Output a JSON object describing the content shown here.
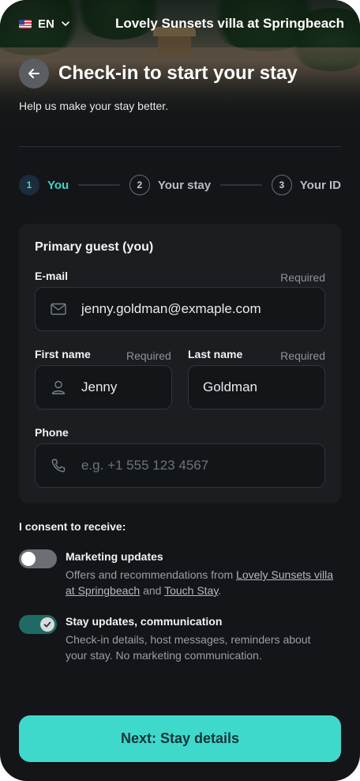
{
  "header": {
    "language": "EN",
    "property_name": "Lovely Sunsets villa at Springbeach",
    "title": "Check-in to start your stay",
    "subtitle": "Help us make your stay better."
  },
  "stepper": {
    "steps": [
      {
        "number": "1",
        "label": "You",
        "state": "active"
      },
      {
        "number": "2",
        "label": "Your stay",
        "state": "upcoming"
      },
      {
        "number": "3",
        "label": "Your ID",
        "state": "upcoming"
      }
    ]
  },
  "form": {
    "card_title": "Primary guest (you)",
    "email": {
      "label": "E-mail",
      "required_text": "Required",
      "value": "jenny.goldman@exmaple.com",
      "icon": "mail-icon"
    },
    "first_name": {
      "label": "First name",
      "required_text": "Required",
      "value": "Jenny",
      "icon": "user-icon"
    },
    "last_name": {
      "label": "Last name",
      "required_text": "Required",
      "value": "Goldman"
    },
    "phone": {
      "label": "Phone",
      "placeholder": "e.g. +1 555 123 4567",
      "value": "",
      "icon": "phone-icon"
    }
  },
  "consent": {
    "title": "I consent to receive:",
    "marketing": {
      "enabled": false,
      "title": "Marketing updates",
      "desc_prefix": "Offers and recommendations from ",
      "link1": "Lovely Sunsets villa at Springbeach",
      "desc_mid": " and ",
      "link2": "Touch Stay",
      "desc_suffix": "."
    },
    "stay_updates": {
      "enabled": true,
      "title": "Stay updates, communication",
      "desc": "Check-in details, host messages, reminders about your stay. No marketing communication."
    }
  },
  "cta": {
    "label": "Next: Stay details"
  },
  "colors": {
    "accent": "#3fd9cc",
    "background": "#131518",
    "card": "#1b1d21",
    "toggle_on": "#1f6b63"
  }
}
